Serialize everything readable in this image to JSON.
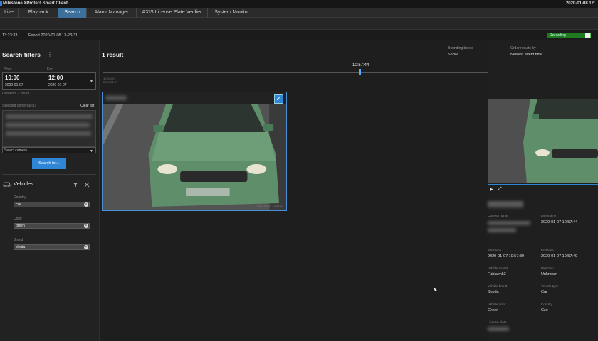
{
  "window": {
    "title": "Milestone XProtect Smart Client",
    "clock": "2020-01-08 12:"
  },
  "tabs": [
    {
      "label": "Live"
    },
    {
      "label": "Playback"
    },
    {
      "label": "Search"
    },
    {
      "label": "Alarm Manager"
    },
    {
      "label": "AXIS License Plate Verifier"
    },
    {
      "label": "System Monitor"
    }
  ],
  "subbar": {
    "time": "13:23:33",
    "export": "Export 2020-01-08 13-23-31",
    "recording": "Recording..."
  },
  "filters": {
    "title": "Search filters",
    "menu": "⋮",
    "start_label": "Start",
    "end_label": "End",
    "start_time": "10:00",
    "start_date": "2020-01-07",
    "end_time": "12:00",
    "end_date": "2020-01-07",
    "duration": "Duration: 2 hours",
    "selected_cameras": "Selected cameras (1)",
    "clear_list": "Clear list",
    "select_camera": "Select camera...",
    "search_button": "Search for...",
    "vehicles_title": "Vehicles",
    "country_label": "Country",
    "country_value": "cze",
    "color_label": "Color",
    "color_value": "green",
    "brand_label": "Brand",
    "brand_value": "skoda"
  },
  "results": {
    "count": "1 result",
    "bbox_label": "Bounding boxes",
    "bbox_value": "Show",
    "order_label": "Order results by",
    "order_value": "Newest event time",
    "timeline_time": "10:57:44",
    "timeline_left": "10:00:00",
    "timeline_left_date": "2020-01-07",
    "card_timestamp": "2020-01-07 10:57:44"
  },
  "details": {
    "camera_name_label": "Camera name",
    "event_time_label": "Event time",
    "event_time": "2020-01-07 10:57:44",
    "start_time_label": "Start time",
    "start_time": "2020-01-07 10:57:39",
    "end_time_label": "End time",
    "end_time": "2020-01-07 10:57:49",
    "vehicle_model_label": "Vehicle model",
    "vehicle_model": "Fabia mk3",
    "direction_label": "Direction",
    "direction": "Unknown",
    "vehicle_brand_label": "Vehicle brand",
    "vehicle_brand": "Skoda",
    "vehicle_type_label": "Vehicle type",
    "vehicle_type": "Car",
    "vehicle_color_label": "Vehicle color",
    "vehicle_color": "Green",
    "country_label": "Country",
    "country": "Cze",
    "license_plate_label": "License plate"
  },
  "colors": {
    "accent": "#2f86d6",
    "car_green": "#5f8e6a",
    "recording_green": "#1f7a1f"
  }
}
